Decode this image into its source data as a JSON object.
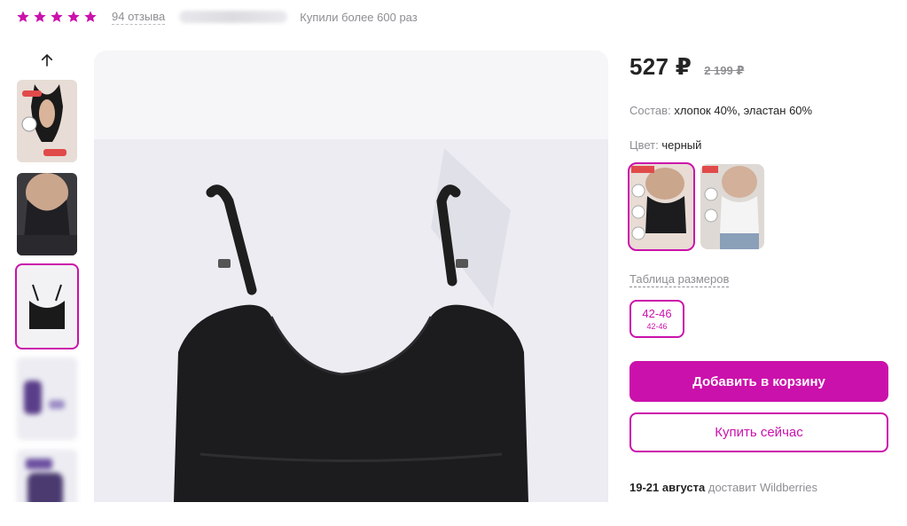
{
  "rating": {
    "stars": 5,
    "star_color": "#cb11ab",
    "reviews_label": "94 отзыва",
    "bought_label": "Купили более 600 раз"
  },
  "gallery": {
    "up_icon": "arrow-up-icon",
    "thumbnails": [
      {
        "name": "thumb-1",
        "desc": "open back bodysuit"
      },
      {
        "name": "thumb-2",
        "desc": "model wearing top"
      },
      {
        "name": "thumb-3",
        "desc": "black top flat",
        "active": true
      },
      {
        "name": "thumb-4",
        "desc": "blurred"
      },
      {
        "name": "thumb-5",
        "desc": "blurred"
      }
    ]
  },
  "product": {
    "price": "527 ₽",
    "old_price": "2 199 ₽",
    "composition_label": "Состав:",
    "composition_value": "хлопок 40%, эластан 60%",
    "color_label": "Цвет:",
    "color_value": "черный",
    "size_table_label": "Таблица размеров",
    "sizes": [
      {
        "main": "42-46",
        "sub": "42-46",
        "selected": true
      }
    ],
    "add_to_cart": "Добавить в корзину",
    "buy_now": "Купить сейчас",
    "delivery_dates": "19-21 августа",
    "delivery_text": "доставит Wildberries",
    "accent_color": "#cb11ab"
  }
}
